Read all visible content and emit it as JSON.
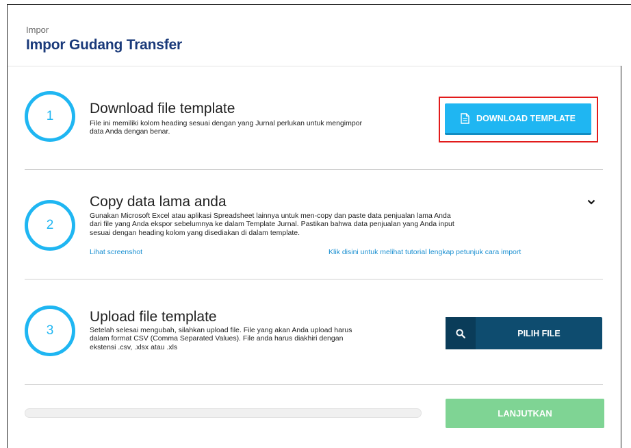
{
  "header": {
    "breadcrumb": "Impor",
    "title": "Impor Gudang Transfer"
  },
  "steps": [
    {
      "number": "1",
      "title": "Download file template",
      "description": [
        "File ini memiliki kolom heading sesuai dengan yang Jurnal perlukan untuk mengimpor",
        "data Anda dengan benar."
      ],
      "button_label": "DOWNLOAD TEMPLATE",
      "button_icon": "document-icon"
    },
    {
      "number": "2",
      "title": "Copy data lama anda",
      "description": [
        "Gunakan Microsoft Excel atau aplikasi Spreadsheet lainnya untuk men-copy dan paste data penjualan lama Anda",
        "dari file yang Anda ekspor sebelumnya ke dalam Template Jurnal. Pastikan bahwa data penjualan yang Anda input",
        "sesuai dengan heading kolom yang disediakan di dalam template."
      ],
      "link_screenshot": "Lihat screenshot",
      "link_tutorial": "Klik disini untuk melihat tutorial lengkap petunjuk cara import",
      "toggle_icon": "chevron-down-icon"
    },
    {
      "number": "3",
      "title": "Upload file template",
      "description": [
        "Setelah selesai mengubah, silahkan upload file. File yang akan Anda upload harus",
        "dalam format CSV (Comma Separated Values). File anda harus diakhiri dengan",
        "ekstensi .csv, .xlsx atau .xls"
      ],
      "button_label": "PILIH FILE",
      "button_icon": "search-icon"
    }
  ],
  "footer": {
    "progress": 0,
    "next_label": "LANJUTKAN"
  },
  "colors": {
    "accent": "#1fb6f2",
    "title": "#1a3a7a",
    "pick_button": "#0e4c6f",
    "next_button": "#7fd494",
    "highlight": "#e21b1b"
  }
}
